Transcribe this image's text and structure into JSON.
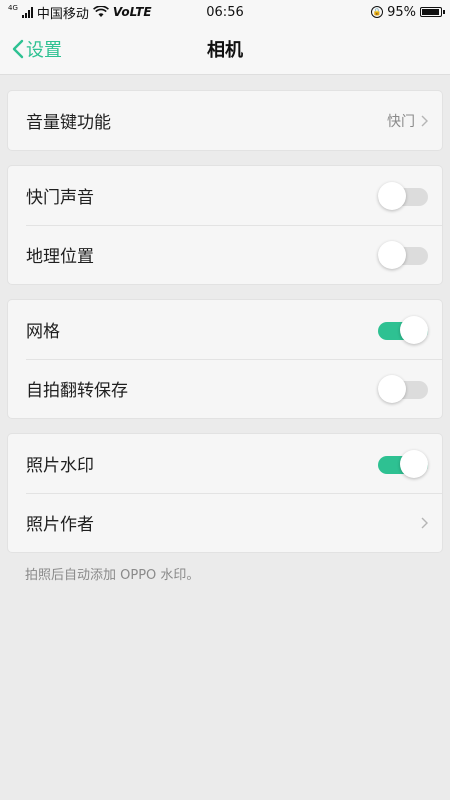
{
  "status_bar": {
    "network_gen": "4G",
    "carrier": "中国移动",
    "volte": "VoLTE",
    "time": "06:56",
    "battery": "95%",
    "battery_level": 0.95
  },
  "nav": {
    "back_label": "设置",
    "title": "相机"
  },
  "groups": [
    {
      "rows": [
        {
          "label": "音量键功能",
          "type": "link",
          "value": "快门"
        }
      ]
    },
    {
      "rows": [
        {
          "label": "快门声音",
          "type": "toggle",
          "on": false
        },
        {
          "label": "地理位置",
          "type": "toggle",
          "on": false
        }
      ]
    },
    {
      "rows": [
        {
          "label": "网格",
          "type": "toggle",
          "on": true
        },
        {
          "label": "自拍翻转保存",
          "type": "toggle",
          "on": false
        }
      ]
    },
    {
      "rows": [
        {
          "label": "照片水印",
          "type": "toggle",
          "on": true
        },
        {
          "label": "照片作者",
          "type": "link",
          "value": ""
        }
      ]
    }
  ],
  "footnote": "拍照后自动添加 OPPO 水印。",
  "colors": {
    "accent": "#2ec192",
    "toggle_off": "#dcdcdc"
  }
}
